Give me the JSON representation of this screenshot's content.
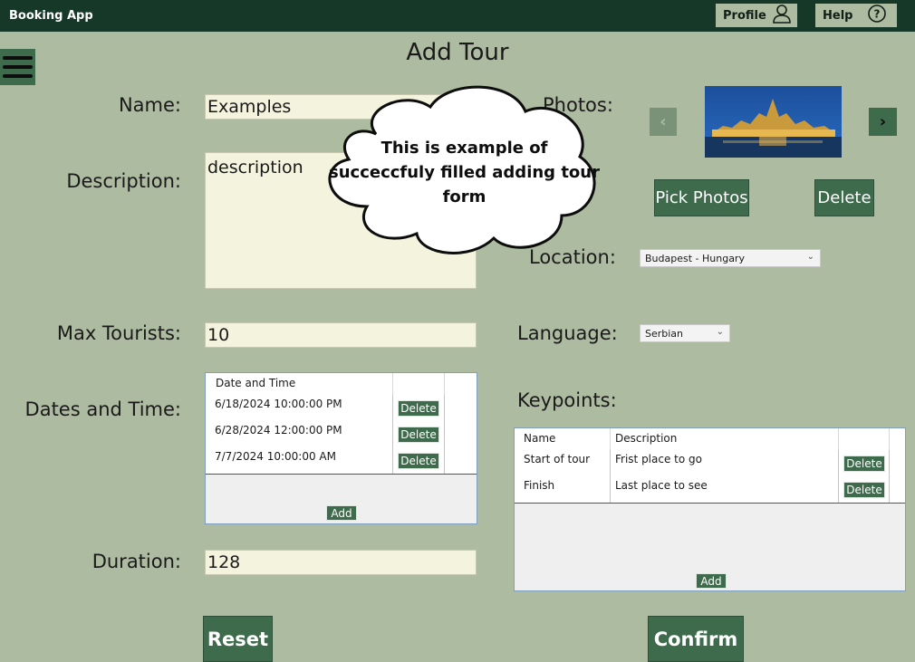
{
  "app": {
    "title": "Booking App"
  },
  "header": {
    "profile_label": "Profile",
    "help_label": "Help",
    "profile_icon": "user-icon",
    "help_icon": "question-circle-icon",
    "menu_icon": "hamburger-menu-icon"
  },
  "page": {
    "title": "Add Tour"
  },
  "form": {
    "name_label": "Name:",
    "name_value": "Examples",
    "description_label": "Description:",
    "description_value": "description",
    "max_tourists_label": "Max Tourists:",
    "max_tourists_value": "10",
    "dates_label": "Dates and Time:",
    "duration_label": "Duration:",
    "duration_value": "128",
    "photos_label": "Photos:",
    "location_label": "Location:",
    "location_value": "Budapest - Hungary",
    "language_label": "Language:",
    "language_value": "Serbian",
    "keypoints_label": "Keypoints:"
  },
  "dates_grid": {
    "header": "Date and Time",
    "rows": [
      {
        "date": "6/18/2024 10:00:00 PM",
        "action": "Delete"
      },
      {
        "date": "6/28/2024 12:00:00 PM",
        "action": "Delete"
      },
      {
        "date": "7/7/2024 10:00:00 AM",
        "action": "Delete"
      }
    ],
    "add_label": "Add"
  },
  "keypoints_grid": {
    "headers": [
      "Name",
      "Description"
    ],
    "rows": [
      {
        "name": "Start of tour",
        "description": "Frist place to go",
        "action": "Delete"
      },
      {
        "name": "Finish",
        "description": "Last place to see",
        "action": "Delete"
      }
    ],
    "add_label": "Add"
  },
  "photos": {
    "pick_label": "Pick Photos",
    "delete_label": "Delete",
    "prev_icon": "chevron-left-icon",
    "next_icon": "chevron-right-icon"
  },
  "callout": {
    "text": "This is example of succeccfuly filled adding tour form"
  },
  "actions": {
    "reset_label": "Reset",
    "confirm_label": "Confirm"
  },
  "colors": {
    "background": "#adbba0",
    "topbar": "#163829",
    "accent": "#3f6b4d",
    "input_bg": "#f4f3dd"
  }
}
